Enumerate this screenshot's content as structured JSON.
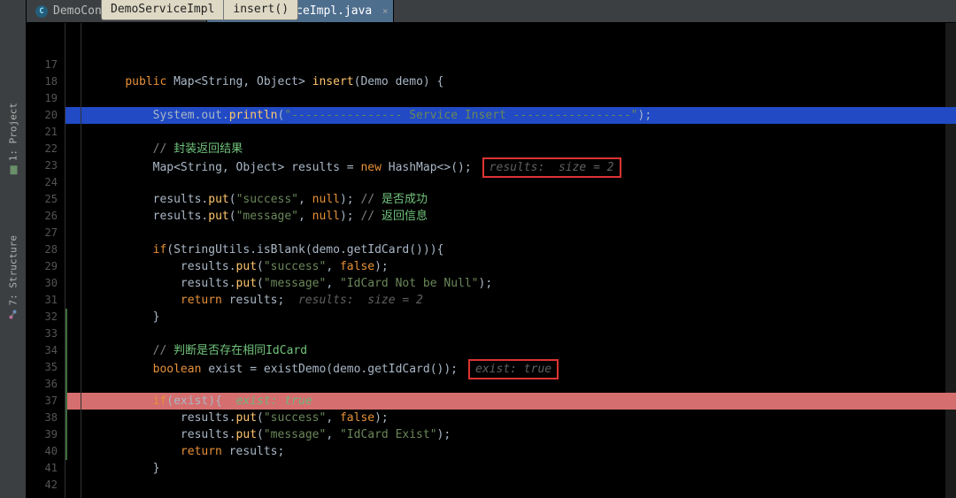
{
  "tabs": [
    {
      "label": "DemoController.java",
      "active": false
    },
    {
      "label": "DemoServiceImpl.java",
      "active": true
    }
  ],
  "toolwindows": {
    "project": "1: Project",
    "structure": "7: Structure"
  },
  "breadcrumb": {
    "cls": "DemoServiceImpl",
    "method": "insert()"
  },
  "lines": {
    "start": 17,
    "end": 42,
    "exec_line": 20,
    "stop_line": 37
  },
  "code": {
    "l18_public": "public",
    "l18_map": "Map",
    "l18_gen": "<String, Object>",
    "l18_fn": "insert",
    "l18_par": "(Demo demo) {",
    "l20_sysout": "System.out.",
    "l20_println": "println",
    "l20_str": "\"---------------- Service Insert -----------------\"",
    "l20_end": ");",
    "l22_cmt": "// ",
    "l22_cmtcn": "封装返回结果",
    "l23_pre": "Map<String, Object> results = ",
    "l23_new": "new",
    "l23_hm": " HashMap<>();",
    "l23_box": "results:  size = 2",
    "l25_r": "results.",
    "l25_put": "put",
    "l25_args": "(",
    "l25_s": "\"success\"",
    "l25_mid": ", ",
    "l25_null": "null",
    "l25_end": "); ",
    "l25_cmt": "// ",
    "l25_cmtcn": "是否成功",
    "l26_s": "\"message\"",
    "l26_cmtcn": "返回信息",
    "l28_if": "if",
    "l28_call": "(StringUtils.isBlank(demo.getIdCard())){",
    "l29_s": "\"success\"",
    "l29_false": "false",
    "l30_s": "\"message\"",
    "l30_val": "\"IdCard Not be Null\"",
    "l31_ret": "return",
    "l31_res": " results;  ",
    "l31_hint": "results:  size = 2",
    "l34_cmt": "// ",
    "l34_cmtcn": "判断是否存在相同IdCard",
    "l35_bool": "boolean",
    "l35_mid": " exist = existDemo(demo.getIdCard());",
    "l35_box": "exist: true",
    "l37_if": "if",
    "l37_cond": "(exist){  ",
    "l37_ann": "exist: true",
    "l39_val": "\"IdCard Exist\"",
    "l40_ret": "return",
    "l40_res": " results;"
  }
}
